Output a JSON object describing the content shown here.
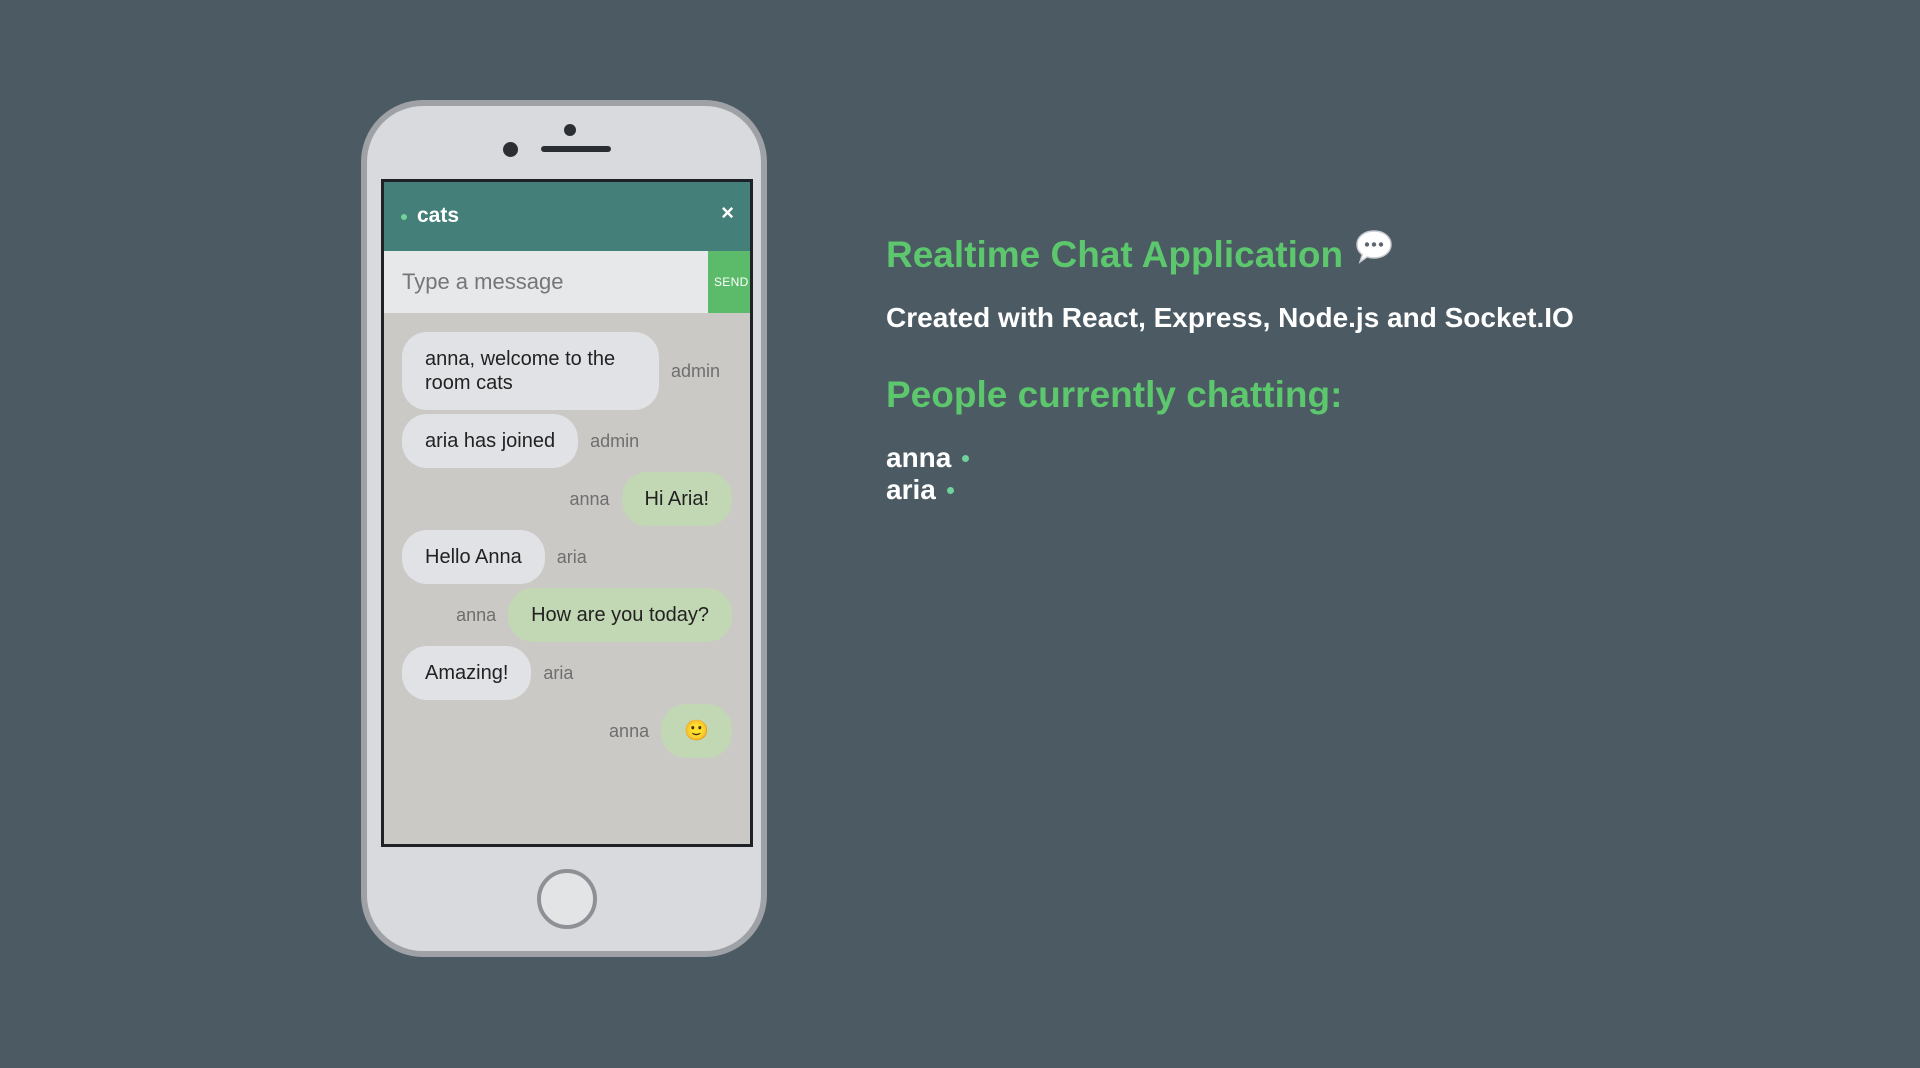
{
  "chat": {
    "room_name": "cats",
    "close_label": "×",
    "input": {
      "value": "",
      "placeholder": "Type a message"
    },
    "send_label": "SEND",
    "messages": [
      {
        "sender": "admin",
        "text": "anna, welcome to the room cats",
        "direction": "incoming"
      },
      {
        "sender": "admin",
        "text": "aria has joined",
        "direction": "incoming"
      },
      {
        "sender": "anna",
        "text": "Hi Aria!",
        "direction": "outgoing"
      },
      {
        "sender": "aria",
        "text": "Hello Anna",
        "direction": "incoming"
      },
      {
        "sender": "anna",
        "text": "How are you today?",
        "direction": "outgoing"
      },
      {
        "sender": "aria",
        "text": "Amazing!",
        "direction": "incoming"
      },
      {
        "sender": "anna",
        "text": "🙂",
        "direction": "outgoing"
      }
    ]
  },
  "info": {
    "title": "Realtime Chat Application",
    "title_icon": "speech-bubble-icon",
    "subtitle": "Created with React, Express, Node.js and Socket.IO",
    "people_heading": "People currently chatting:",
    "people": [
      "anna",
      "aria"
    ]
  },
  "colors": {
    "background": "#4b5a63",
    "header": "#447f79",
    "accent": "#5cc76c",
    "send_button": "#5cbb6a",
    "incoming_bubble": "#e0e2e5",
    "outgoing_bubble": "#c2d7b4",
    "online_dot": "#6fd29a"
  }
}
